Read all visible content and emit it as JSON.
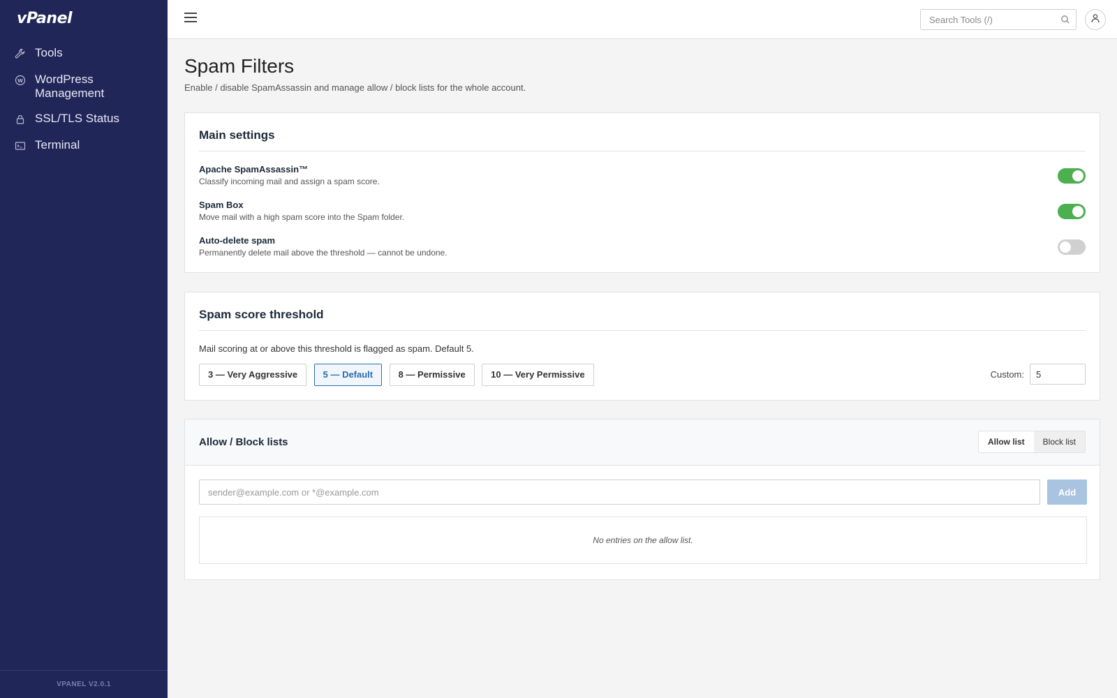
{
  "app": {
    "logo": "vPanel",
    "version": "VPANEL V2.0.1"
  },
  "sidebar": {
    "items": [
      {
        "label": "Tools",
        "icon": "wrench-icon"
      },
      {
        "label": "WordPress Management",
        "icon": "wordpress-icon"
      },
      {
        "label": "SSL/TLS Status",
        "icon": "lock-icon"
      },
      {
        "label": "Terminal",
        "icon": "terminal-icon"
      }
    ]
  },
  "topbar": {
    "search_placeholder": "Search Tools (/)"
  },
  "page": {
    "title": "Spam Filters",
    "description": "Enable / disable SpamAssassin and manage allow / block lists for the whole account."
  },
  "main_settings": {
    "title": "Main settings",
    "settings": [
      {
        "name": "Apache SpamAssassin™",
        "desc": "Classify incoming mail and assign a spam score.",
        "enabled": true
      },
      {
        "name": "Spam Box",
        "desc": "Move mail with a high spam score into the Spam folder.",
        "enabled": true
      },
      {
        "name": "Auto-delete spam",
        "desc": "Permanently delete mail above the threshold — cannot be undone.",
        "enabled": false
      }
    ]
  },
  "threshold": {
    "title": "Spam score threshold",
    "description": "Mail scoring at or above this threshold is flagged as spam. Default 5.",
    "options": [
      "3 — Very Aggressive",
      "5 — Default",
      "8 — Permissive",
      "10 — Very Permissive"
    ],
    "selected": "5 — Default",
    "custom_label": "Custom:",
    "custom_value": "5"
  },
  "lists": {
    "title": "Allow / Block lists",
    "tabs": [
      "Allow list",
      "Block list"
    ],
    "active_tab": "Allow list",
    "input_placeholder": "sender@example.com or *@example.com",
    "add_label": "Add",
    "empty_text": "No entries on the allow list."
  },
  "colors": {
    "sidebar": "#212658",
    "toggle_on": "#4caf50",
    "accent": "#2a6db0"
  }
}
